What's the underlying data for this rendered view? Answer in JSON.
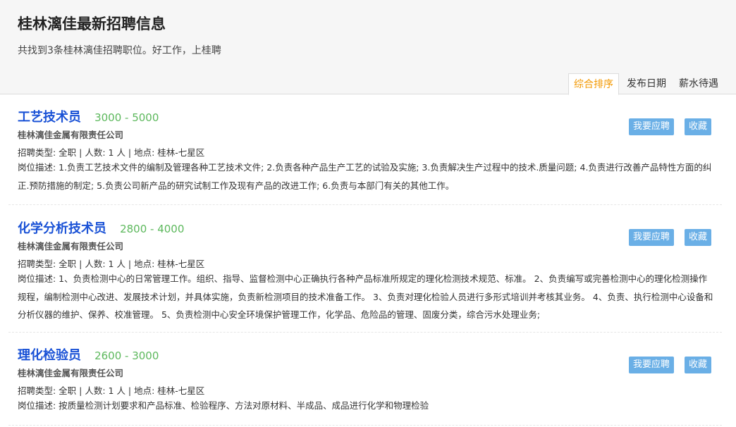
{
  "header": {
    "title": "桂林漓佳最新招聘信息",
    "subtitle": "共找到3条桂林漓佳招聘职位。好工作，上桂聘"
  },
  "sort_tabs": [
    {
      "label": "综合排序",
      "active": true
    },
    {
      "label": "发布日期",
      "active": false
    },
    {
      "label": "薪水待遇",
      "active": false
    }
  ],
  "jobs": [
    {
      "title": "工艺技术员",
      "salary": "3000 - 5000",
      "company": "桂林漓佳金属有限责任公司",
      "info": "招聘类型:   全职 | 人数: 1 人 | 地点:   桂林-七星区",
      "description": "岗位描述:   1.负责工艺技术文件的编制及管理各种工艺技术文件;   2.负责各种产品生产工艺的试验及实施;   3.负责解决生产过程中的技术.质量问题;   4.负责进行改善产品特性方面的纠正.预防措施的制定;   5.负责公司新产品的研究试制工作及现有产品的改进工作;   6.负责与本部门有关的其他工作。",
      "apply_label": "我要应聘",
      "fav_label": "收藏"
    },
    {
      "title": "化学分析技术员",
      "salary": "2800 - 4000",
      "company": "桂林漓佳金属有限责任公司",
      "info": "招聘类型:   全职 | 人数: 1 人 | 地点:   桂林-七星区",
      "description": "岗位描述:   1、负责检测中心的日常管理工作。组织、指导、监督检测中心正确执行各种产品标准所规定的理化检测技术规范、标准。 2、负责编写或完善检测中心的理化检测操作规程，编制检测中心改进、发展技术计划，并具体实施，负责新检测项目的技术准备工作。 3、负责对理化检验人员进行多形式培训并考核其业务。 4、负责、执行检测中心设备和分析仪器的维护、保养、校准管理。 5、负责检测中心安全环境保护管理工作，化学品、危险品的管理、固废分类，综合污水处理业务;",
      "apply_label": "我要应聘",
      "fav_label": "收藏"
    },
    {
      "title": "理化检验员",
      "salary": "2600 - 3000",
      "company": "桂林漓佳金属有限责任公司",
      "info": "招聘类型:   全职 | 人数: 1 人 | 地点:   桂林-七星区",
      "description": "岗位描述:   按质量检测计划要求和产品标准、检验程序、方法对原材料、半成品、成品进行化学和物理检验",
      "apply_label": "我要应聘",
      "fav_label": "收藏"
    }
  ]
}
